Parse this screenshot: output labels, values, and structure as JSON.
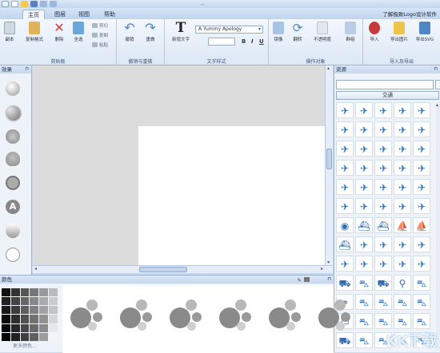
{
  "window": {
    "title": "...",
    "help_text": "了解极致Logo设计软件"
  },
  "tabs": [
    "主页",
    "图层",
    "视图",
    "帮助"
  ],
  "ribbon": {
    "clipboard": {
      "label": "剪贴板",
      "buttons": [
        "副本",
        "复制格式",
        "删除",
        "全选"
      ],
      "small": [
        "剪切",
        "复制",
        "粘贴"
      ]
    },
    "undo": {
      "label": "撤销与重做",
      "buttons": [
        "撤销",
        "重做"
      ]
    },
    "text": {
      "label": "文字样式",
      "new_text": "新增文字",
      "font": "A Yummy Apology",
      "size": "",
      "bold": "B",
      "italic": "I",
      "underline": "U"
    },
    "operate": {
      "label": "操作对象",
      "buttons": [
        "镜像",
        "翻转",
        "不透明度",
        "群组"
      ]
    },
    "export": {
      "label": "导入及导出",
      "buttons": [
        "导入",
        "导出图片",
        "导出SVG"
      ]
    }
  },
  "effects_panel": {
    "title": "效果"
  },
  "resources_panel": {
    "title": "资源",
    "category": "交通",
    "search_placeholder": ""
  },
  "color_panel": {
    "title": "颜色",
    "more": "更多颜色..."
  },
  "watermark": {
    "main": "KK下载",
    "sub": "www.kkx.net"
  },
  "icons": [
    "plane-icon",
    "plane-icon",
    "plane-icon",
    "plane-icon",
    "plane-icon",
    "plane-icon",
    "plane-icon",
    "plane-icon",
    "plane-icon",
    "plane-icon",
    "plane-icon",
    "plane-icon",
    "plane-icon",
    "plane-icon",
    "plane-icon",
    "plane-icon",
    "plane-icon",
    "plane-icon",
    "plane-icon",
    "plane-icon",
    "plane-icon",
    "plane-icon",
    "plane-icon",
    "plane-icon",
    "plane-icon",
    "plane-icon",
    "plane-icon",
    "plane-icon",
    "plane-icon",
    "plane-icon",
    "ufo-icon",
    "ship-icon",
    "ship-icon",
    "sailboat-icon",
    "sailboat-icon",
    "ship-icon",
    "plane-icon",
    "plane-icon",
    "plane-icon",
    "plane-icon",
    "plane-icon",
    "plane-icon",
    "plane-icon",
    "plane-icon",
    "plane-icon",
    "truck-icon",
    "car-icon",
    "truck-icon",
    "motorcycle-icon",
    "car-icon",
    "bicycle-icon",
    "car-icon",
    "car-icon",
    "car-icon",
    "car-icon",
    "bus-icon",
    "car-icon",
    "car-icon",
    "car-icon",
    "car-icon",
    "truck-icon",
    "car-icon",
    "car-icon",
    "car-icon",
    "car-icon"
  ],
  "colors": {
    "accent": "#2f6cb4",
    "ribbon_bg": "#e4eef9",
    "canvas_bg": "#dcdcdc"
  }
}
